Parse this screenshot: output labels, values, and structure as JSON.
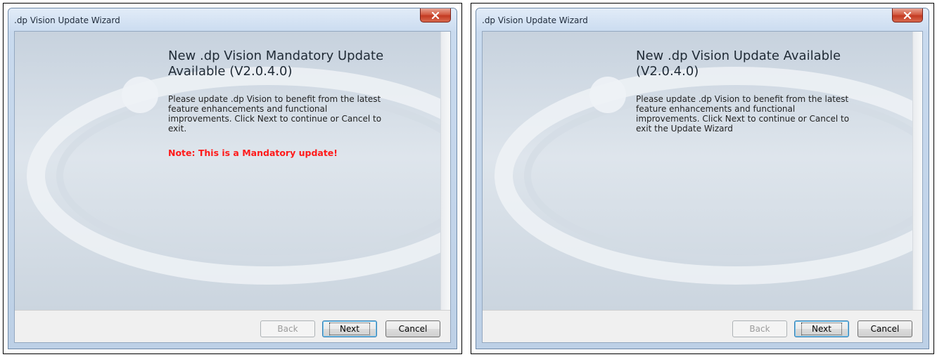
{
  "dialogs": [
    {
      "window_title": ".dp Vision Update Wizard",
      "heading": "New .dp Vision Mandatory Update Available (V2.0.4.0)",
      "body": "Please update .dp Vision to benefit from the latest feature enhancements and functional improvements. Click Next to continue or Cancel to exit.",
      "note": "Note: This is a Mandatory update!",
      "buttons": {
        "back": "Back",
        "next": "Next",
        "cancel": "Cancel"
      }
    },
    {
      "window_title": ".dp Vision Update Wizard",
      "heading": "New .dp Vision Update Available (V2.0.4.0)",
      "body": "Please update .dp Vision to benefit from the latest feature enhancements and functional improvements. Click Next to continue or Cancel to exit the Update Wizard",
      "buttons": {
        "back": "Back",
        "next": "Next",
        "cancel": "Cancel"
      }
    }
  ],
  "icons": {
    "close": "close-icon",
    "logo": "swoosh-logo-icon"
  },
  "colors": {
    "note_red": "#ff1a1a",
    "close_button": "#c33a22",
    "title_bar": "#cbdcf0"
  }
}
